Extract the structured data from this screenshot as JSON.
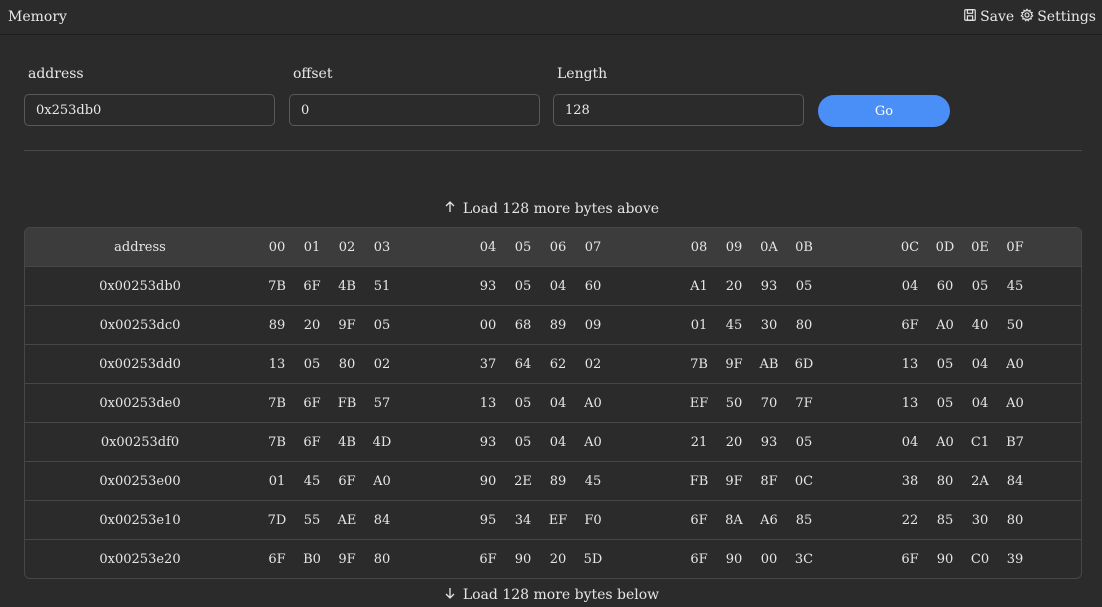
{
  "window": {
    "title": "Memory"
  },
  "toolbar": {
    "save_label": "Save",
    "settings_label": "Settings"
  },
  "form": {
    "address_label": "address",
    "address_value": "0x253db0",
    "offset_label": "offset",
    "offset_value": "0",
    "length_label": "Length",
    "length_value": "128",
    "go_label": "Go"
  },
  "load": {
    "above_label": "Load 128 more bytes above",
    "below_label": "Load 128 more bytes below"
  },
  "table": {
    "address_header": "address",
    "byte_headers": [
      "00",
      "01",
      "02",
      "03",
      "04",
      "05",
      "06",
      "07",
      "08",
      "09",
      "0A",
      "0B",
      "0C",
      "0D",
      "0E",
      "0F"
    ],
    "rows": [
      {
        "address": "0x00253db0",
        "bytes": [
          "7B",
          "6F",
          "4B",
          "51",
          "93",
          "05",
          "04",
          "60",
          "A1",
          "20",
          "93",
          "05",
          "04",
          "60",
          "05",
          "45"
        ]
      },
      {
        "address": "0x00253dc0",
        "bytes": [
          "89",
          "20",
          "9F",
          "05",
          "00",
          "68",
          "89",
          "09",
          "01",
          "45",
          "30",
          "80",
          "6F",
          "A0",
          "40",
          "50"
        ]
      },
      {
        "address": "0x00253dd0",
        "bytes": [
          "13",
          "05",
          "80",
          "02",
          "37",
          "64",
          "62",
          "02",
          "7B",
          "9F",
          "AB",
          "6D",
          "13",
          "05",
          "04",
          "A0"
        ]
      },
      {
        "address": "0x00253de0",
        "bytes": [
          "7B",
          "6F",
          "FB",
          "57",
          "13",
          "05",
          "04",
          "A0",
          "EF",
          "50",
          "70",
          "7F",
          "13",
          "05",
          "04",
          "A0"
        ]
      },
      {
        "address": "0x00253df0",
        "bytes": [
          "7B",
          "6F",
          "4B",
          "4D",
          "93",
          "05",
          "04",
          "A0",
          "21",
          "20",
          "93",
          "05",
          "04",
          "A0",
          "C1",
          "B7"
        ]
      },
      {
        "address": "0x00253e00",
        "bytes": [
          "01",
          "45",
          "6F",
          "A0",
          "90",
          "2E",
          "89",
          "45",
          "FB",
          "9F",
          "8F",
          "0C",
          "38",
          "80",
          "2A",
          "84"
        ]
      },
      {
        "address": "0x00253e10",
        "bytes": [
          "7D",
          "55",
          "AE",
          "84",
          "95",
          "34",
          "EF",
          "F0",
          "6F",
          "8A",
          "A6",
          "85",
          "22",
          "85",
          "30",
          "80"
        ]
      },
      {
        "address": "0x00253e20",
        "bytes": [
          "6F",
          "B0",
          "9F",
          "80",
          "6F",
          "90",
          "20",
          "5D",
          "6F",
          "90",
          "00",
          "3C",
          "6F",
          "90",
          "C0",
          "39"
        ]
      }
    ]
  },
  "icons": {
    "save": "floppy-disk-icon",
    "settings": "gear-icon",
    "up": "arrow-up-icon",
    "down": "arrow-down-icon"
  },
  "colors": {
    "accent": "#4a8ff7",
    "background": "#2b2b2b",
    "header_bg": "#3c3c3c"
  }
}
